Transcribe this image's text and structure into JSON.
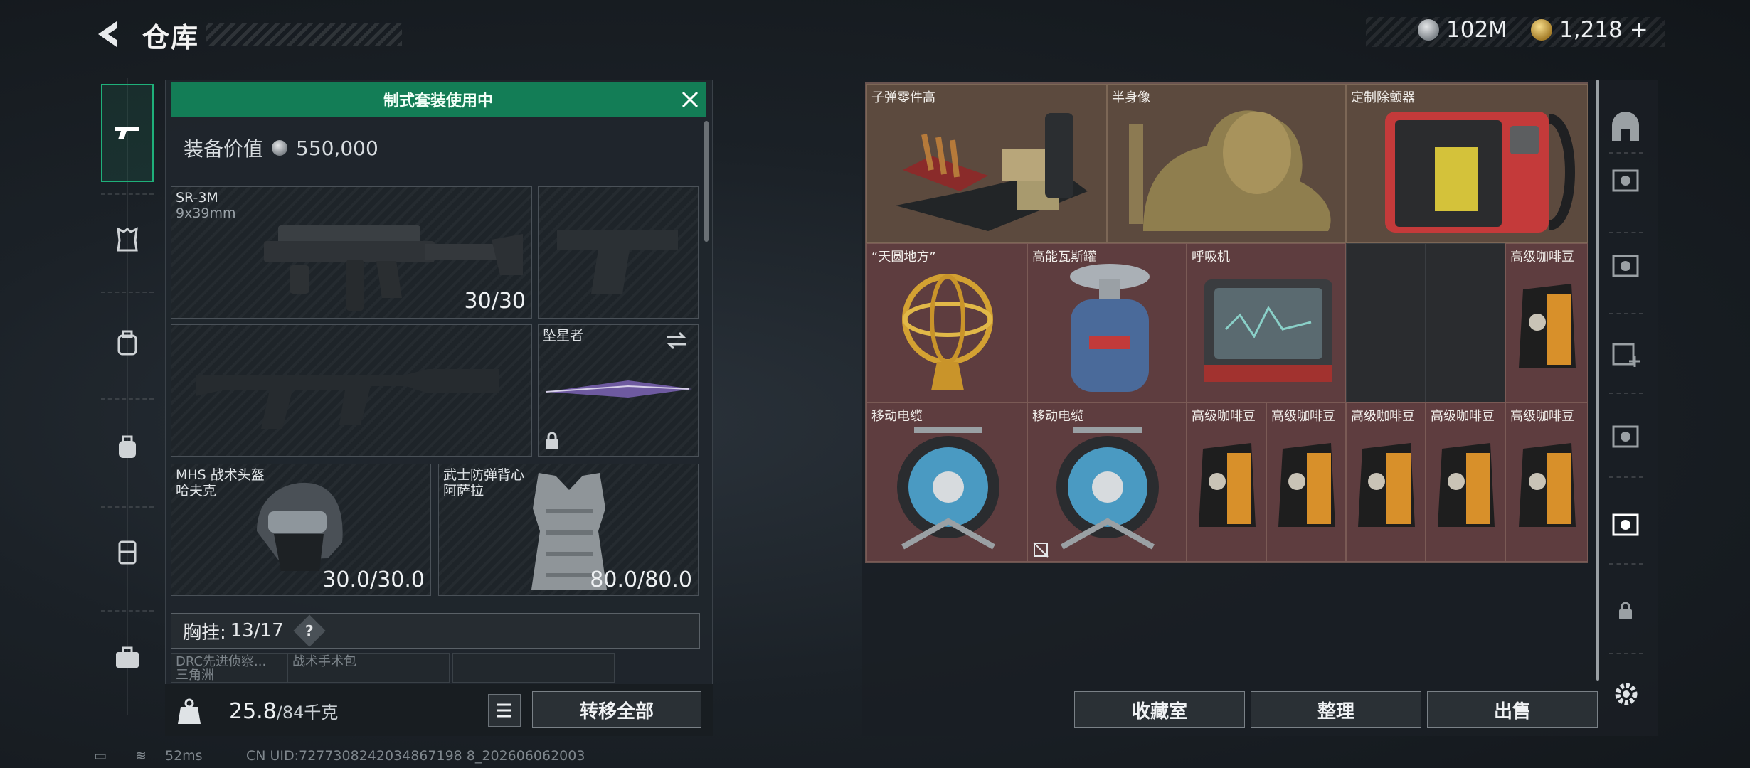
{
  "header": {
    "title": "仓库"
  },
  "currency": {
    "silver": "102M",
    "gold": "1,218",
    "gold_add": "+"
  },
  "equipment": {
    "banner": "制式套装使用中",
    "value_label": "装备价值",
    "value": "550,000",
    "primary": {
      "name": "SR-3M",
      "ammo": "9x39mm",
      "count": "30/30"
    },
    "melee": {
      "name": "坠星者"
    },
    "helmet": {
      "name": "MHS 战术头盔",
      "sub": "哈夫克",
      "durability": "30.0/30.0"
    },
    "armor": {
      "name": "武士防弹背心",
      "sub": "阿萨拉",
      "durability": "80.0/80.0"
    },
    "chest_rig": {
      "label": "胸挂:",
      "count": "13/17",
      "help": "?"
    },
    "mini_items": [
      {
        "line1": "DRC先进侦察...",
        "line2": "三角洲"
      },
      {
        "line1": "战术手术包",
        "line2": ""
      },
      {
        "line1": "",
        "line2": ""
      }
    ],
    "weight": {
      "current": "25.8",
      "max": "/84千克"
    },
    "transfer_all": "转移全部"
  },
  "storage": {
    "items": [
      {
        "name": "子弹零件高"
      },
      {
        "name": "半身像"
      },
      {
        "name": "定制除颤器"
      },
      {
        "name": "“天圆地方”"
      },
      {
        "name": "高能瓦斯罐"
      },
      {
        "name": "呼吸机"
      },
      {
        "name": "高级咖啡豆"
      },
      {
        "name": "移动电缆"
      },
      {
        "name": "移动电缆"
      },
      {
        "name": "高级咖啡豆"
      },
      {
        "name": "高级咖啡豆"
      },
      {
        "name": "高级咖啡豆"
      },
      {
        "name": "高级咖啡豆"
      },
      {
        "name": "高级咖啡豆"
      }
    ],
    "buttons": {
      "collection": "收藏室",
      "sort": "整理",
      "sell": "出售"
    }
  },
  "footer": {
    "ping": "52ms",
    "uid": "CN UID:7277308242034867198 8_202606062003"
  }
}
